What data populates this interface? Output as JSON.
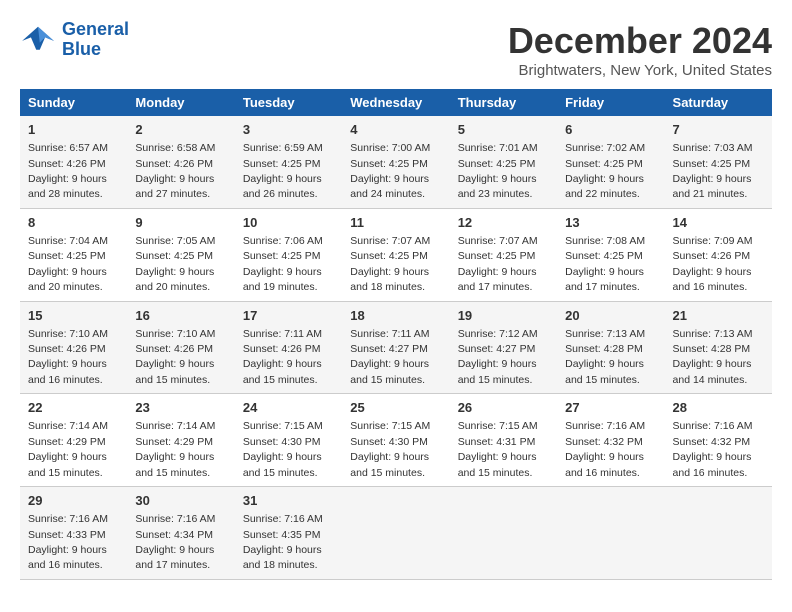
{
  "header": {
    "logo_line1": "General",
    "logo_line2": "Blue",
    "month": "December 2024",
    "location": "Brightwaters, New York, United States"
  },
  "weekdays": [
    "Sunday",
    "Monday",
    "Tuesday",
    "Wednesday",
    "Thursday",
    "Friday",
    "Saturday"
  ],
  "rows": [
    [
      {
        "day": "1",
        "sunrise": "6:57 AM",
        "sunset": "4:26 PM",
        "daylight": "9 hours and 28 minutes."
      },
      {
        "day": "2",
        "sunrise": "6:58 AM",
        "sunset": "4:26 PM",
        "daylight": "9 hours and 27 minutes."
      },
      {
        "day": "3",
        "sunrise": "6:59 AM",
        "sunset": "4:25 PM",
        "daylight": "9 hours and 26 minutes."
      },
      {
        "day": "4",
        "sunrise": "7:00 AM",
        "sunset": "4:25 PM",
        "daylight": "9 hours and 24 minutes."
      },
      {
        "day": "5",
        "sunrise": "7:01 AM",
        "sunset": "4:25 PM",
        "daylight": "9 hours and 23 minutes."
      },
      {
        "day": "6",
        "sunrise": "7:02 AM",
        "sunset": "4:25 PM",
        "daylight": "9 hours and 22 minutes."
      },
      {
        "day": "7",
        "sunrise": "7:03 AM",
        "sunset": "4:25 PM",
        "daylight": "9 hours and 21 minutes."
      }
    ],
    [
      {
        "day": "8",
        "sunrise": "7:04 AM",
        "sunset": "4:25 PM",
        "daylight": "9 hours and 20 minutes."
      },
      {
        "day": "9",
        "sunrise": "7:05 AM",
        "sunset": "4:25 PM",
        "daylight": "9 hours and 20 minutes."
      },
      {
        "day": "10",
        "sunrise": "7:06 AM",
        "sunset": "4:25 PM",
        "daylight": "9 hours and 19 minutes."
      },
      {
        "day": "11",
        "sunrise": "7:07 AM",
        "sunset": "4:25 PM",
        "daylight": "9 hours and 18 minutes."
      },
      {
        "day": "12",
        "sunrise": "7:07 AM",
        "sunset": "4:25 PM",
        "daylight": "9 hours and 17 minutes."
      },
      {
        "day": "13",
        "sunrise": "7:08 AM",
        "sunset": "4:25 PM",
        "daylight": "9 hours and 17 minutes."
      },
      {
        "day": "14",
        "sunrise": "7:09 AM",
        "sunset": "4:26 PM",
        "daylight": "9 hours and 16 minutes."
      }
    ],
    [
      {
        "day": "15",
        "sunrise": "7:10 AM",
        "sunset": "4:26 PM",
        "daylight": "9 hours and 16 minutes."
      },
      {
        "day": "16",
        "sunrise": "7:10 AM",
        "sunset": "4:26 PM",
        "daylight": "9 hours and 15 minutes."
      },
      {
        "day": "17",
        "sunrise": "7:11 AM",
        "sunset": "4:26 PM",
        "daylight": "9 hours and 15 minutes."
      },
      {
        "day": "18",
        "sunrise": "7:11 AM",
        "sunset": "4:27 PM",
        "daylight": "9 hours and 15 minutes."
      },
      {
        "day": "19",
        "sunrise": "7:12 AM",
        "sunset": "4:27 PM",
        "daylight": "9 hours and 15 minutes."
      },
      {
        "day": "20",
        "sunrise": "7:13 AM",
        "sunset": "4:28 PM",
        "daylight": "9 hours and 15 minutes."
      },
      {
        "day": "21",
        "sunrise": "7:13 AM",
        "sunset": "4:28 PM",
        "daylight": "9 hours and 14 minutes."
      }
    ],
    [
      {
        "day": "22",
        "sunrise": "7:14 AM",
        "sunset": "4:29 PM",
        "daylight": "9 hours and 15 minutes."
      },
      {
        "day": "23",
        "sunrise": "7:14 AM",
        "sunset": "4:29 PM",
        "daylight": "9 hours and 15 minutes."
      },
      {
        "day": "24",
        "sunrise": "7:15 AM",
        "sunset": "4:30 PM",
        "daylight": "9 hours and 15 minutes."
      },
      {
        "day": "25",
        "sunrise": "7:15 AM",
        "sunset": "4:30 PM",
        "daylight": "9 hours and 15 minutes."
      },
      {
        "day": "26",
        "sunrise": "7:15 AM",
        "sunset": "4:31 PM",
        "daylight": "9 hours and 15 minutes."
      },
      {
        "day": "27",
        "sunrise": "7:16 AM",
        "sunset": "4:32 PM",
        "daylight": "9 hours and 16 minutes."
      },
      {
        "day": "28",
        "sunrise": "7:16 AM",
        "sunset": "4:32 PM",
        "daylight": "9 hours and 16 minutes."
      }
    ],
    [
      {
        "day": "29",
        "sunrise": "7:16 AM",
        "sunset": "4:33 PM",
        "daylight": "9 hours and 16 minutes."
      },
      {
        "day": "30",
        "sunrise": "7:16 AM",
        "sunset": "4:34 PM",
        "daylight": "9 hours and 17 minutes."
      },
      {
        "day": "31",
        "sunrise": "7:16 AM",
        "sunset": "4:35 PM",
        "daylight": "9 hours and 18 minutes."
      },
      null,
      null,
      null,
      null
    ]
  ],
  "labels": {
    "sunrise_prefix": "Sunrise: ",
    "sunset_prefix": "Sunset: ",
    "daylight_prefix": "Daylight: "
  }
}
